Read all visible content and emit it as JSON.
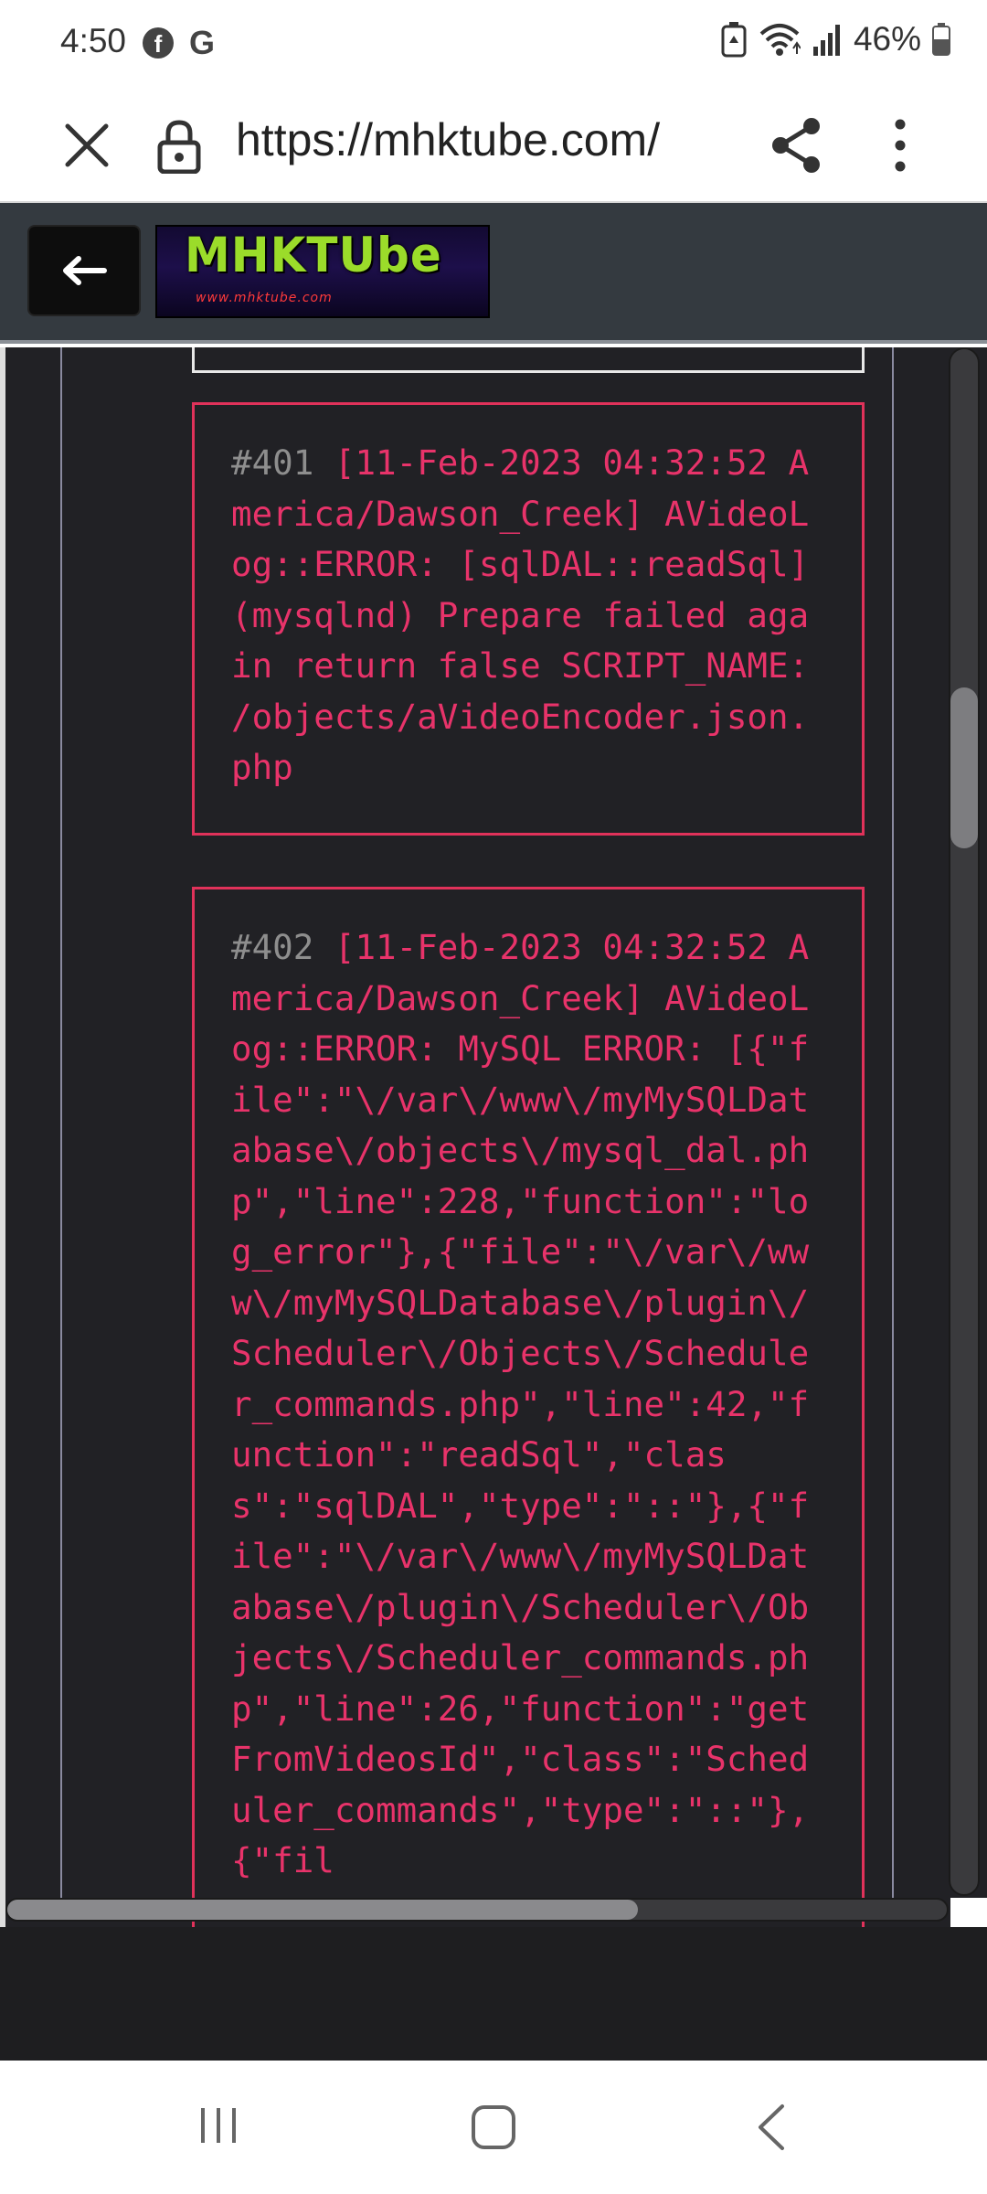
{
  "status_bar": {
    "time": "4:50",
    "left_icons": [
      "facebook-icon",
      "google-icon"
    ],
    "fb_glyph": "f",
    "g_glyph": "G",
    "right_icons": [
      "battery-saver-icon",
      "wifi-icon",
      "signal-icon",
      "battery-icon"
    ],
    "battery_level": "46%"
  },
  "browser": {
    "url": "https://mhktube.com/"
  },
  "site": {
    "logo_text": "MHKTUbe",
    "logo_subtext": "www.mhktube.com"
  },
  "logs": [
    {
      "number": "#401",
      "text": "[11-Feb-2023 04:32:52 America/Dawson_Creek] AVideoLog::ERROR: [sqlDAL::readSql] (mysqlnd) Prepare failed again return false SCRIPT_NAME: /objects/aVideoEncoder.json.php"
    },
    {
      "number": "#402",
      "text": "[11-Feb-2023 04:32:52 America/Dawson_Creek] AVideoLog::ERROR: MySQL ERROR: [{\"file\":\"\\/var\\/www\\/myMySQLDatabase\\/objects\\/mysql_dal.php\",\"line\":228,\"function\":\"log_error\"},{\"file\":\"\\/var\\/www\\/myMySQLDatabase\\/plugin\\/Scheduler\\/Objects\\/Scheduler_commands.php\",\"line\":42,\"function\":\"readSql\",\"class\":\"sqlDAL\",\"type\":\"::\"},{\"file\":\"\\/var\\/www\\/myMySQLDatabase\\/plugin\\/Scheduler\\/Objects\\/Scheduler_commands.php\",\"line\":26,\"function\":\"getFromVideosId\",\"class\":\"Scheduler_commands\",\"type\":\"::\"},{\"fil"
    }
  ],
  "colors": {
    "log_text": "#e8336a",
    "log_border": "#e0325a",
    "log_number": "#8e8e8e",
    "page_bg": "#212125",
    "header_bg": "#343a40",
    "logo_green": "#9bdc2a"
  },
  "nav": {
    "icons": [
      "recents-icon",
      "home-icon",
      "back-icon"
    ]
  }
}
